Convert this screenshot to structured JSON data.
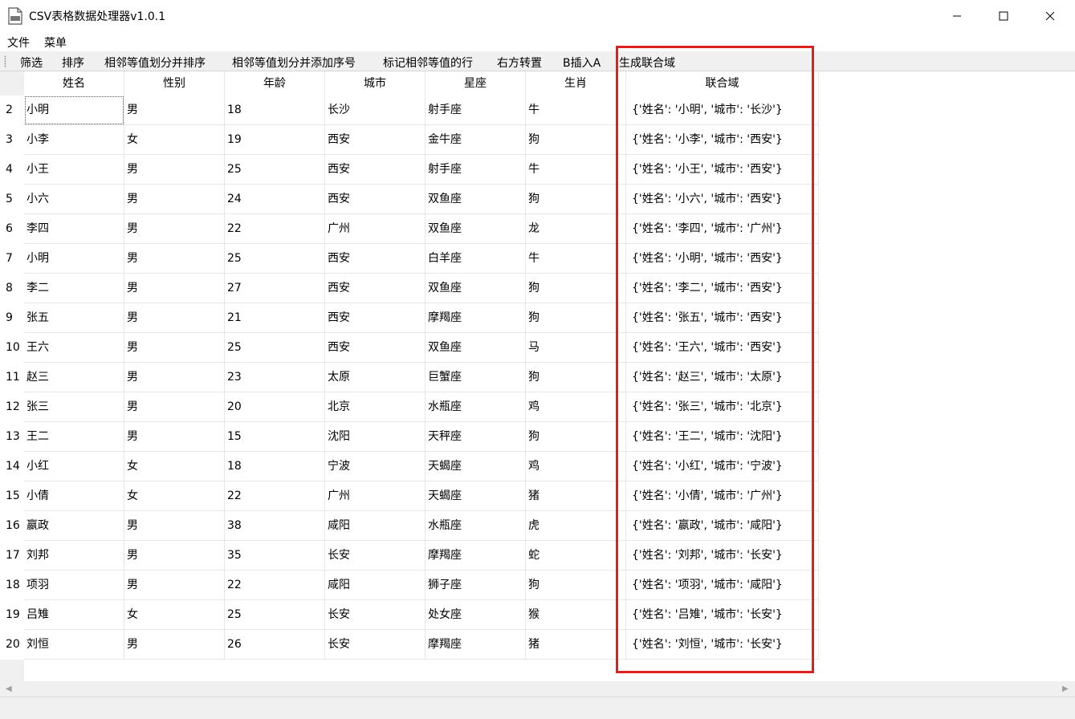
{
  "window": {
    "title": "CSV表格数据处理器v1.0.1"
  },
  "menu": {
    "file": "文件",
    "menu": "菜单"
  },
  "toolbar": {
    "filter": "筛选",
    "sort": "排序",
    "merge_sort": "相邻等值划分并排序",
    "merge_seq": "相邻等值划分并添加序号",
    "mark_rows": "标记相邻等值的行",
    "transpose": "右方转置",
    "b_insert_a": "B插入A",
    "gen_union": "生成联合域"
  },
  "table": {
    "headers": [
      "姓名",
      "性别",
      "年龄",
      "城市",
      "星座",
      "生肖",
      "联合域"
    ],
    "rows": [
      {
        "n": "2",
        "c": [
          "小明",
          "男",
          "18",
          "长沙",
          "射手座",
          "牛",
          "{'姓名': '小明', '城市': '长沙'}"
        ]
      },
      {
        "n": "3",
        "c": [
          "小李",
          "女",
          "19",
          "西安",
          "金牛座",
          "狗",
          "{'姓名': '小李', '城市': '西安'}"
        ]
      },
      {
        "n": "4",
        "c": [
          "小王",
          "男",
          "25",
          "西安",
          "射手座",
          "牛",
          "{'姓名': '小王', '城市': '西安'}"
        ]
      },
      {
        "n": "5",
        "c": [
          "小六",
          "男",
          "24",
          "西安",
          "双鱼座",
          "狗",
          "{'姓名': '小六', '城市': '西安'}"
        ]
      },
      {
        "n": "6",
        "c": [
          "李四",
          "男",
          "22",
          "广州",
          "双鱼座",
          "龙",
          "{'姓名': '李四', '城市': '广州'}"
        ]
      },
      {
        "n": "7",
        "c": [
          "小明",
          "男",
          "25",
          "西安",
          "白羊座",
          "牛",
          "{'姓名': '小明', '城市': '西安'}"
        ]
      },
      {
        "n": "8",
        "c": [
          "李二",
          "男",
          "27",
          "西安",
          "双鱼座",
          "狗",
          "{'姓名': '李二', '城市': '西安'}"
        ]
      },
      {
        "n": "9",
        "c": [
          "张五",
          "男",
          "21",
          "西安",
          "摩羯座",
          "狗",
          "{'姓名': '张五', '城市': '西安'}"
        ]
      },
      {
        "n": "10",
        "c": [
          "王六",
          "男",
          "25",
          "西安",
          "双鱼座",
          "马",
          "{'姓名': '王六', '城市': '西安'}"
        ]
      },
      {
        "n": "11",
        "c": [
          "赵三",
          "男",
          "23",
          "太原",
          "巨蟹座",
          "狗",
          "{'姓名': '赵三', '城市': '太原'}"
        ]
      },
      {
        "n": "12",
        "c": [
          "张三",
          "男",
          "20",
          "北京",
          "水瓶座",
          "鸡",
          "{'姓名': '张三', '城市': '北京'}"
        ]
      },
      {
        "n": "13",
        "c": [
          "王二",
          "男",
          "15",
          "沈阳",
          "天秤座",
          "狗",
          "{'姓名': '王二', '城市': '沈阳'}"
        ]
      },
      {
        "n": "14",
        "c": [
          "小红",
          "女",
          "18",
          "宁波",
          "天蝎座",
          "鸡",
          "{'姓名': '小红', '城市': '宁波'}"
        ]
      },
      {
        "n": "15",
        "c": [
          "小倩",
          "女",
          "22",
          "广州",
          "天蝎座",
          "猪",
          "{'姓名': '小倩', '城市': '广州'}"
        ]
      },
      {
        "n": "16",
        "c": [
          "嬴政",
          "男",
          "38",
          "咸阳",
          "水瓶座",
          "虎",
          "{'姓名': '嬴政', '城市': '咸阳'}"
        ]
      },
      {
        "n": "17",
        "c": [
          "刘邦",
          "男",
          "35",
          "长安",
          "摩羯座",
          "蛇",
          "{'姓名': '刘邦', '城市': '长安'}"
        ]
      },
      {
        "n": "18",
        "c": [
          "项羽",
          "男",
          "22",
          "咸阳",
          "狮子座",
          "狗",
          "{'姓名': '项羽', '城市': '咸阳'}"
        ]
      },
      {
        "n": "19",
        "c": [
          "吕雉",
          "女",
          "25",
          "长安",
          "处女座",
          "猴",
          "{'姓名': '吕雉', '城市': '长安'}"
        ]
      },
      {
        "n": "20",
        "c": [
          "刘恒",
          "男",
          "26",
          "长安",
          "摩羯座",
          "猪",
          "{'姓名': '刘恒', '城市': '长安'}"
        ]
      }
    ]
  },
  "colors": {
    "highlight": "#e02020",
    "chrome": "#f0f0f0",
    "gridline": "#e6e6e6"
  }
}
